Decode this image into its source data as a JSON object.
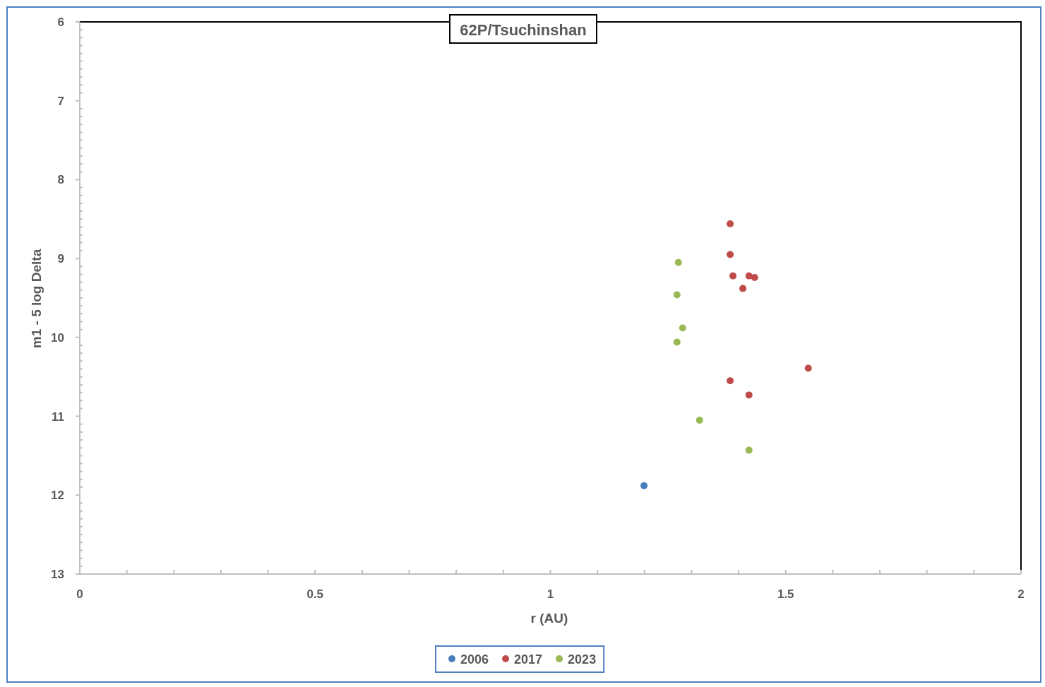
{
  "chart_data": {
    "type": "scatter",
    "title": "62P/Tsuchinshan",
    "xlabel": "r (AU)",
    "ylabel": "m1 - 5 log Delta",
    "xlim": [
      0,
      2
    ],
    "ylim": [
      13,
      6
    ],
    "xticks": [
      0,
      0.5,
      1,
      1.5,
      2
    ],
    "yticks": [
      6,
      7,
      8,
      9,
      10,
      11,
      12,
      13
    ],
    "legend": true,
    "series": [
      {
        "name": "2006",
        "color": "#4a7ebb",
        "x": [
          1.199
        ],
        "values": [
          11.88
        ]
      },
      {
        "name": "2017",
        "color": "#be4b48",
        "x": [
          1.382,
          1.382,
          1.388,
          1.422,
          1.434,
          1.409,
          1.548,
          1.382,
          1.422
        ],
        "values": [
          8.56,
          8.95,
          9.22,
          9.22,
          9.24,
          9.38,
          10.39,
          10.55,
          10.73
        ]
      },
      {
        "name": "2023",
        "color": "#98b954",
        "x": [
          1.272,
          1.269,
          1.281,
          1.269,
          1.317,
          1.422
        ],
        "values": [
          9.05,
          9.46,
          9.88,
          10.06,
          11.05,
          11.43
        ]
      }
    ]
  }
}
